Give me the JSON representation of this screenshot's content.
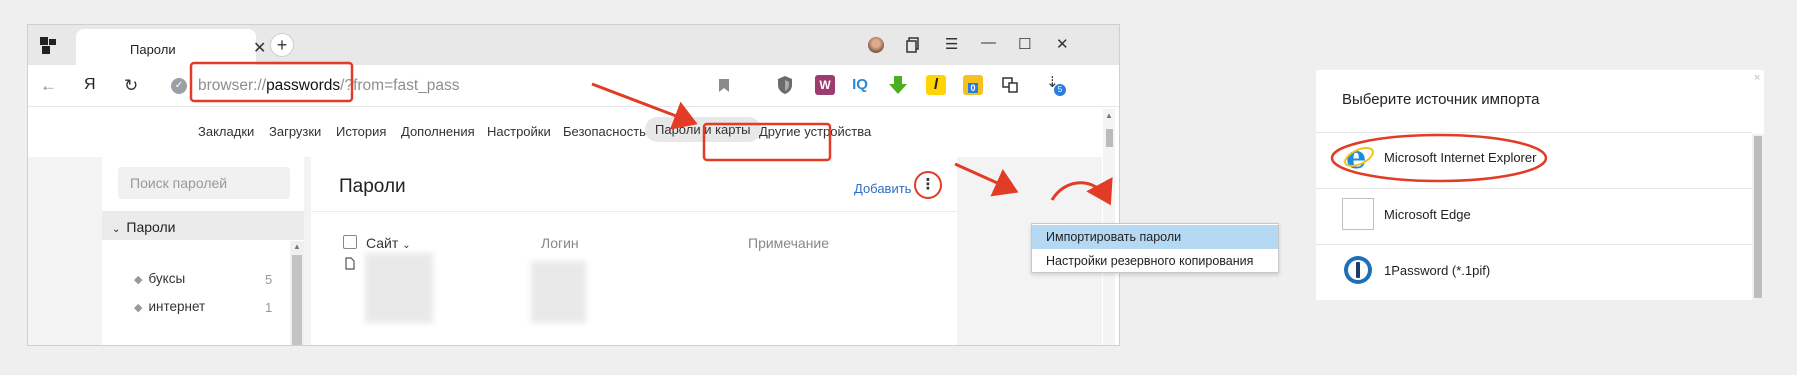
{
  "browser": {
    "tab": {
      "title": "Пароли",
      "close": "✕",
      "new": "+"
    },
    "address": {
      "scheme": "browser://",
      "host": "passwords",
      "path": "/",
      "query": "?from=fast_pass"
    },
    "nav": {
      "back": "←",
      "yandex": "Я",
      "reload": "↻"
    },
    "window_controls": {
      "menu": "☰",
      "minimize": "—",
      "maximize": "☐",
      "close": "✕"
    },
    "extensions": [
      {
        "name": "bookmark-icon",
        "label": ""
      },
      {
        "name": "shield-ext-icon",
        "label": ""
      },
      {
        "name": "woocommerce-ext-icon",
        "label": "W"
      },
      {
        "name": "iq-ext-icon",
        "label": "IQ"
      },
      {
        "name": "download-arrow-ext-icon",
        "label": ""
      },
      {
        "name": "italic-l-ext-icon",
        "label": "l"
      },
      {
        "name": "abbyy-ext-icon",
        "label": "0"
      },
      {
        "name": "translate-ext-icon",
        "label": ""
      },
      {
        "name": "downloads-icon",
        "label": "5"
      }
    ],
    "menu": {
      "items": [
        "Закладки",
        "Загрузки",
        "История",
        "Дополнения",
        "Настройки",
        "Безопасность",
        "Пароли и карты",
        "Другие устройства"
      ],
      "active": "Пароли и карты"
    },
    "sidebar": {
      "search_placeholder": "Поиск паролей",
      "header": "Пароли",
      "items": [
        {
          "label": "буксы",
          "count": "5"
        },
        {
          "label": "интернет",
          "count": "1"
        }
      ]
    },
    "main": {
      "title": "Пароли",
      "add": "Добавить",
      "more": "⋮",
      "columns": {
        "site": "Сайт",
        "login": "Логин",
        "note": "Примечание"
      }
    },
    "dropdown": [
      "Импортировать пароли",
      "Настройки резервного копирования"
    ]
  },
  "import_panel": {
    "title": "Выберите источник импорта",
    "close": "×",
    "sources": [
      "Microsoft Internet Explorer",
      "Microsoft Edge",
      "1Password (*.1pif)"
    ]
  },
  "colors": {
    "annotation": "#e23b26",
    "link": "#2e6ec4",
    "dropdown_highlight": "#b6d9f3"
  }
}
